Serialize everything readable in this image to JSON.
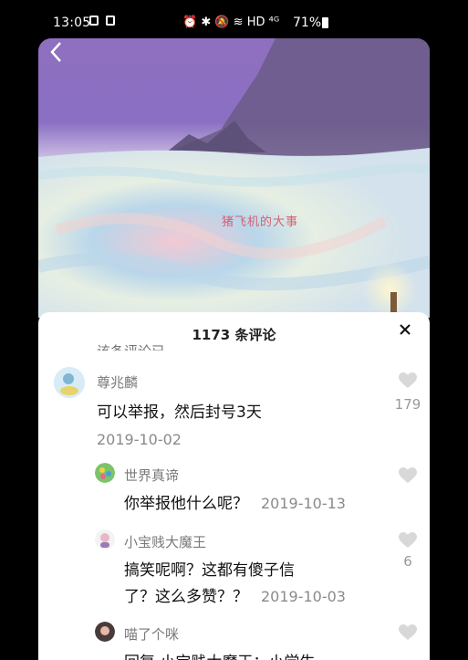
{
  "status_bar": {
    "time": "13:05",
    "icons_right": "⏰ ✱ 🔕 ≋ HD ⁴ᴳ",
    "battery": "71%"
  },
  "video": {
    "overlay_text": "猪飞机的大事"
  },
  "comments_panel": {
    "title": "1173 条评论",
    "close_symbol": "×",
    "cut_off_text": "该条评论已"
  },
  "comments": [
    {
      "user": "尊兆麟",
      "text": "可以举报，然后封号3天",
      "date": "2019-10-02",
      "likes": "179"
    },
    {
      "user": "世界真谛",
      "text": "你举报他什么呢？",
      "date": "2019-10-13",
      "likes": ""
    },
    {
      "user": "小宝贱大魔王",
      "text_line1": "搞笑呢啊？这都有傻子信",
      "text_line2": "了？这么多赞？？",
      "date": "2019-10-03",
      "likes": "6"
    },
    {
      "user": "喵了个咪",
      "text": "回复 小宝贱大魔王：小学生",
      "likes": ""
    }
  ],
  "colors": {
    "sheet_bg": "#ffffff",
    "heart": "#d8d8d8",
    "sky": "#8a6fc3"
  }
}
